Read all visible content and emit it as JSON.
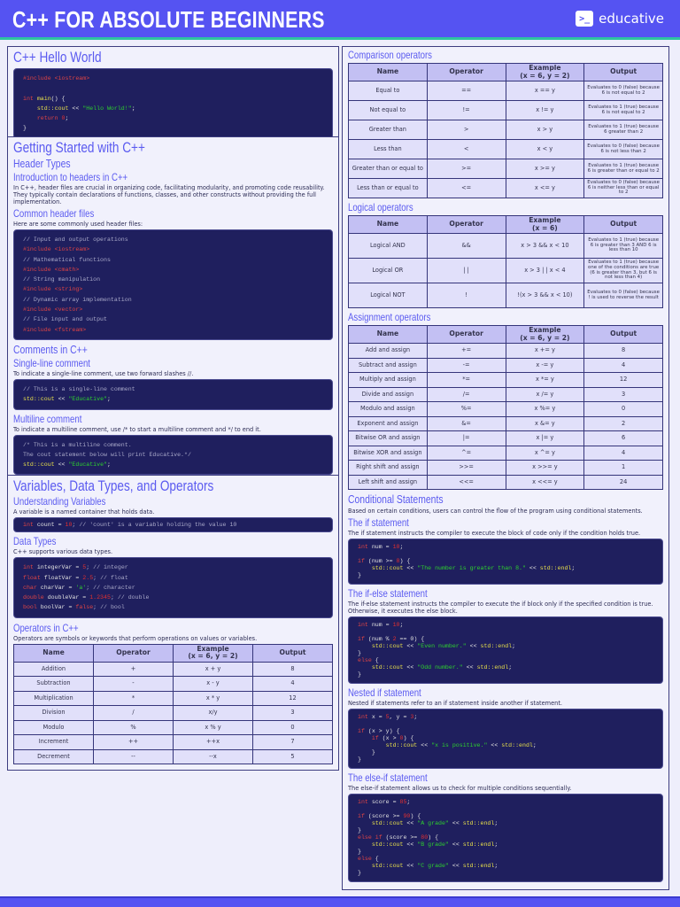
{
  "header": {
    "title": "C++ FOR ABSOLUTE BEGINNERS",
    "logo_text": "educative",
    "logo_icon": "terminal-icon"
  },
  "hello": {
    "title": "C++ Hello World",
    "code": [
      [
        [
          "k",
          "#include <iostream>"
        ]
      ],
      [],
      [
        [
          "k",
          "int "
        ],
        [
          "f",
          "main"
        ],
        [
          "p0",
          "() {"
        ]
      ],
      [
        [
          "p0",
          "    "
        ],
        [
          "f",
          "std::cout"
        ],
        [
          "p0",
          " << "
        ],
        [
          "s",
          "\"Hello World!\""
        ],
        [
          "p0",
          ";"
        ]
      ],
      [
        [
          "p0",
          "    "
        ],
        [
          "k",
          "return "
        ],
        [
          "n",
          "0"
        ],
        [
          "p0",
          ";"
        ]
      ],
      [
        [
          "p0",
          "}"
        ]
      ]
    ]
  },
  "getting_started": {
    "title": "Getting Started with C++",
    "header_types": "Header Types",
    "intro_title": "Introduction to headers in C++",
    "intro_text": "In C++, header files are crucial in organizing code, facilitating modularity, and promoting code reusability. They typically contain declarations of functions, classes, and other constructs without providing the full implementation.",
    "common_title": "Common header files",
    "common_text": "Here are some commonly used header files:",
    "headers_code": [
      [
        [
          "c",
          "// Input and output operations"
        ]
      ],
      [
        [
          "k",
          "#include <iostream>"
        ]
      ],
      [
        [
          "c",
          "// Mathematical functions"
        ]
      ],
      [
        [
          "k",
          "#include <cmath>"
        ]
      ],
      [
        [
          "c",
          "// String manipulation"
        ]
      ],
      [
        [
          "k",
          "#include <string>"
        ]
      ],
      [
        [
          "c",
          "// Dynamic array implementation"
        ]
      ],
      [
        [
          "k",
          "#include <vector>"
        ]
      ],
      [
        [
          "c",
          "// File input and output"
        ]
      ],
      [
        [
          "k",
          "#include <fstream>"
        ]
      ]
    ],
    "comments_title": "Comments in C++",
    "single_title": "Single-line comment",
    "single_text": "To indicate a single-line comment, use two forward slashes //.",
    "single_code": [
      [
        [
          "c",
          "// This is a single-line comment"
        ]
      ],
      [
        [
          "f",
          "std::cout"
        ],
        [
          "p0",
          " << "
        ],
        [
          "s",
          "\"Educative\""
        ],
        [
          "p0",
          ";"
        ]
      ]
    ],
    "multi_title": "Multiline comment",
    "multi_text": "To indicate a multiline comment, use  /* to start a multiline comment and */ to end it.",
    "multi_code": [
      [
        [
          "c",
          "/* This is a multiline comment."
        ]
      ],
      [
        [
          "c",
          "The cout statement below will print Educative.*/"
        ]
      ],
      [
        [
          "f",
          "std::cout"
        ],
        [
          "p0",
          " << "
        ],
        [
          "s",
          "\"Educative\""
        ],
        [
          "p0",
          ";"
        ]
      ]
    ]
  },
  "variables": {
    "title": "Variables, Data Types, and Operators",
    "understanding_title": "Understanding Variables",
    "understanding_text": "A variable is a named container that holds data.",
    "var_code": [
      [
        [
          "k",
          "int "
        ],
        [
          "p0",
          "count = "
        ],
        [
          "n",
          "10"
        ],
        [
          "c",
          "; // 'count' is a variable holding the value 10"
        ]
      ]
    ],
    "types_title": "Data Types",
    "types_text": "C++ supports various data types.",
    "types_code": [
      [
        [
          "k",
          "int "
        ],
        [
          "p0",
          "integerVar = "
        ],
        [
          "n",
          "5"
        ],
        [
          "c",
          "; // integer"
        ]
      ],
      [
        [
          "k",
          "float "
        ],
        [
          "p0",
          "floatVar = "
        ],
        [
          "n",
          "2.5"
        ],
        [
          "c",
          "; // float"
        ]
      ],
      [
        [
          "k",
          "char "
        ],
        [
          "p0",
          "charVar = "
        ],
        [
          "s",
          "'a'"
        ],
        [
          "c",
          "; // character"
        ]
      ],
      [
        [
          "k",
          "double "
        ],
        [
          "p0",
          "doubleVar = "
        ],
        [
          "n",
          "1.2345"
        ],
        [
          "c",
          "; // double"
        ]
      ],
      [
        [
          "k",
          "bool "
        ],
        [
          "p0",
          "boolVar = "
        ],
        [
          "k",
          "false"
        ],
        [
          "c",
          "; // bool"
        ]
      ]
    ],
    "operators_title": "Operators in C++",
    "operators_text": "Operators are symbols or keywords that perform operations on values or variables.",
    "arith_table": {
      "headers": [
        "Name",
        "Operator",
        "Example\n(x = 6, y = 2)",
        "Output"
      ],
      "rows": [
        [
          "Addition",
          "+",
          "x + y",
          "8"
        ],
        [
          "Subtraction",
          "-",
          "x - y",
          "4"
        ],
        [
          "Multiplication",
          "*",
          "x * y",
          "12"
        ],
        [
          "Division",
          "/",
          "x/y",
          "3"
        ],
        [
          "Modulo",
          "%",
          "x % y",
          "0"
        ],
        [
          "Increment",
          "++",
          "++x",
          "7"
        ],
        [
          "Decrement",
          "--",
          "--x",
          "5"
        ]
      ]
    }
  },
  "right": {
    "comparison_title": "Comparison operators",
    "comparison_table": {
      "headers": [
        "Name",
        "Operator",
        "Example\n(x = 6, y = 2)",
        "Output"
      ],
      "rows": [
        [
          "Equal to",
          "==",
          "x == y",
          "Evaluates to 0 (false) because 6 is not equal to 2"
        ],
        [
          "Not equal to",
          "!=",
          "x != y",
          "Evaluates to 1 (true) because 6 is not equal to 2"
        ],
        [
          "Greater than",
          ">",
          "x > y",
          "Evaluates to 1 (true) because 6 greater than 2"
        ],
        [
          "Less than",
          "<",
          "x < y",
          "Evaluates to 0 (false) because 6 is not less than 2"
        ],
        [
          "Greater than or equal to",
          ">=",
          "x >= y",
          "Evaluates to 1 (true) because 6 is greater than or equal to 2"
        ],
        [
          "Less than or equal to",
          "<=",
          "x <= y",
          "Evaluates to 0 (false) because 6 is neither less than or equal to 2"
        ]
      ]
    },
    "logical_title": "Logical operators",
    "logical_table": {
      "headers": [
        "Name",
        "Operator",
        "Example\n(x = 6)",
        "Output"
      ],
      "rows": [
        [
          "Logical AND",
          "&&",
          "x > 3 &&  x < 10",
          "Evaluates to 1 (true) because 6 is greater than 3 AND 6 is less than 10"
        ],
        [
          "Logical OR",
          "| |",
          "x > 3 | | x < 4",
          "Evaluates to 1 (true) because one of the conditions are true (6 is greater than 3, but 6 is not less than 4)"
        ],
        [
          "Logical NOT",
          "!",
          "!(x > 3 && x < 10)",
          "Evaluates to 0 (false) because ! is used to reverse the result"
        ]
      ]
    },
    "assignment_title": "Assignment operators",
    "assignment_table": {
      "headers": [
        "Name",
        "Operator",
        "Example\n(x = 6, y = 2)",
        "Output"
      ],
      "rows": [
        [
          "Add and assign",
          "+=",
          "x += y",
          "8"
        ],
        [
          "Subtract and assign",
          "-=",
          "x -= y",
          "4"
        ],
        [
          "Multiply and assign",
          "*=",
          "x *= y",
          "12"
        ],
        [
          "Divide and assign",
          "/=",
          "x /= y",
          "3"
        ],
        [
          "Modulo and assign",
          "%=",
          "x %= y",
          "0"
        ],
        [
          "Exponent and assign",
          "&=",
          "x &= y",
          "2"
        ],
        [
          "Bitwise OR and assign",
          "|=",
          "x |= y",
          "6"
        ],
        [
          "Bitwise XOR and assign",
          "^=",
          "x ^= y",
          "4"
        ],
        [
          "Right shift and assign",
          ">>=",
          "x >>= y",
          "1"
        ],
        [
          "Left shift and assign",
          "<<=",
          "x <<= y",
          "24"
        ]
      ]
    },
    "conditional_title": "Conditional Statements",
    "conditional_text": "Based on certain conditions, users can control the flow of the program using conditional statements.",
    "if_title": "The if statement",
    "if_text": "The if statement instructs the compiler to execute the block of code only if the condition holds true.",
    "if_code": [
      [
        [
          "k",
          "int "
        ],
        [
          "p0",
          "num = "
        ],
        [
          "n",
          "10"
        ],
        [
          "p0",
          ";"
        ]
      ],
      [],
      [
        [
          "k",
          "if "
        ],
        [
          "p0",
          "(num >= "
        ],
        [
          "n",
          "8"
        ],
        [
          "p0",
          ") {"
        ]
      ],
      [
        [
          "p0",
          "    "
        ],
        [
          "f",
          "std::cout"
        ],
        [
          "p0",
          " << "
        ],
        [
          "s",
          "\"The number is greater than 8.\""
        ],
        [
          "p0",
          " << "
        ],
        [
          "f",
          "std::endl"
        ],
        [
          "p0",
          ";"
        ]
      ],
      [
        [
          "p0",
          "}"
        ]
      ]
    ],
    "ifelse_title": "The if-else statement",
    "ifelse_text": "The if-else statement instructs the compiler to execute the if block only if the specified condition is true. Otherwise, it executes the else block.",
    "ifelse_code": [
      [
        [
          "k",
          "int "
        ],
        [
          "p0",
          "num = "
        ],
        [
          "n",
          "10"
        ],
        [
          "p0",
          ";"
        ]
      ],
      [],
      [
        [
          "k",
          "if "
        ],
        [
          "p0",
          "(num % "
        ],
        [
          "n",
          "2"
        ],
        [
          "p0",
          " == 0) {"
        ]
      ],
      [
        [
          "p0",
          "    "
        ],
        [
          "f",
          "std::cout"
        ],
        [
          "p0",
          " << "
        ],
        [
          "s",
          "\"Even number.\""
        ],
        [
          "p0",
          " << "
        ],
        [
          "f",
          "std::endl"
        ],
        [
          "p0",
          ";"
        ]
      ],
      [
        [
          "p0",
          "}"
        ]
      ],
      [
        [
          "k",
          "else "
        ],
        [
          "p0",
          "{"
        ]
      ],
      [
        [
          "p0",
          "    "
        ],
        [
          "f",
          "std::cout"
        ],
        [
          "p0",
          " << "
        ],
        [
          "s",
          "\"Odd number.\""
        ],
        [
          "p0",
          " << "
        ],
        [
          "f",
          "std::endl"
        ],
        [
          "p0",
          ";"
        ]
      ],
      [
        [
          "p0",
          "}"
        ]
      ]
    ],
    "nested_title": "Nested if statement",
    "nested_text": "Nested if statements refer to an if statement inside another  if statement.",
    "nested_code": [
      [
        [
          "k",
          "int "
        ],
        [
          "p0",
          "x = "
        ],
        [
          "n",
          "5"
        ],
        [
          "p0",
          ", y = "
        ],
        [
          "n",
          "3"
        ],
        [
          "p0",
          ";"
        ]
      ],
      [],
      [
        [
          "k",
          "if "
        ],
        [
          "p0",
          "(x > y) {"
        ]
      ],
      [
        [
          "p0",
          "    "
        ],
        [
          "k",
          "if "
        ],
        [
          "p0",
          "(x > "
        ],
        [
          "n",
          "0"
        ],
        [
          "p0",
          ") {"
        ]
      ],
      [
        [
          "p0",
          "        "
        ],
        [
          "f",
          "std::cout"
        ],
        [
          "p0",
          " << "
        ],
        [
          "s",
          "\"x is positive.\""
        ],
        [
          "p0",
          " << "
        ],
        [
          "f",
          "std::endl"
        ],
        [
          "p0",
          ";"
        ]
      ],
      [
        [
          "p0",
          "    }"
        ]
      ],
      [
        [
          "p0",
          "}"
        ]
      ]
    ],
    "elseif_title": "The else-if statement",
    "elseif_text": "The else-if statement allows us to check for multiple conditions sequentially.",
    "elseif_code": [
      [
        [
          "k",
          "int "
        ],
        [
          "p0",
          "score = "
        ],
        [
          "n",
          "85"
        ],
        [
          "p0",
          ";"
        ]
      ],
      [],
      [
        [
          "k",
          "if "
        ],
        [
          "p0",
          "(score >= "
        ],
        [
          "n",
          "90"
        ],
        [
          "p0",
          ") {"
        ]
      ],
      [
        [
          "p0",
          "    "
        ],
        [
          "f",
          "std::cout"
        ],
        [
          "p0",
          " << "
        ],
        [
          "s",
          "\"A grade\""
        ],
        [
          "p0",
          " << "
        ],
        [
          "f",
          "std::endl"
        ],
        [
          "p0",
          ";"
        ]
      ],
      [
        [
          "p0",
          "}"
        ]
      ],
      [
        [
          "k",
          "else if "
        ],
        [
          "p0",
          "(score >= "
        ],
        [
          "n",
          "80"
        ],
        [
          "p0",
          ") {"
        ]
      ],
      [
        [
          "p0",
          "    "
        ],
        [
          "f",
          "std::cout"
        ],
        [
          "p0",
          " << "
        ],
        [
          "s",
          "\"B grade\""
        ],
        [
          "p0",
          " << "
        ],
        [
          "f",
          "std::endl"
        ],
        [
          "p0",
          ";"
        ]
      ],
      [
        [
          "p0",
          "}"
        ]
      ],
      [
        [
          "k",
          "else "
        ],
        [
          "p0",
          "{"
        ]
      ],
      [
        [
          "p0",
          "    "
        ],
        [
          "f",
          "std::cout"
        ],
        [
          "p0",
          " << "
        ],
        [
          "s",
          "\"C grade\""
        ],
        [
          "p0",
          " << "
        ],
        [
          "f",
          "std::endl"
        ],
        [
          "p0",
          ";"
        ]
      ],
      [
        [
          "p0",
          "}"
        ]
      ]
    ]
  }
}
